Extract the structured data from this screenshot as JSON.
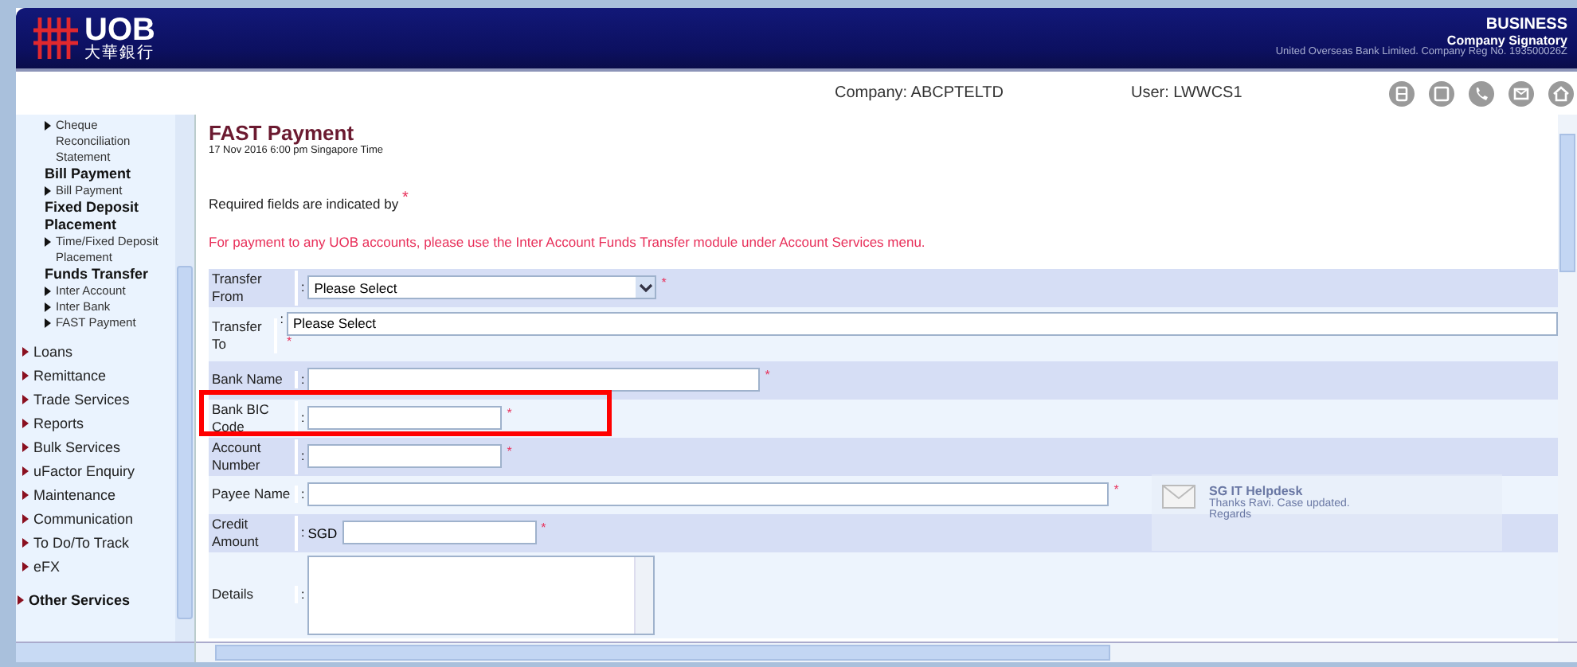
{
  "header": {
    "logo_text": "UOB",
    "logo_chinese": "大華銀行",
    "product": "BUSINESS",
    "role": "Company Signatory",
    "registration": "United Overseas Bank Limited. Company Reg No. 193500026Z"
  },
  "info_bar": {
    "company": "Company: ABCPTELTD",
    "user": "User: LWWCS1"
  },
  "sidebar": {
    "items": [
      {
        "kind": "sub",
        "label": "Cheque Reconciliation Statement"
      },
      {
        "kind": "heading",
        "label": "Bill Payment"
      },
      {
        "kind": "sub",
        "label": "Bill Payment"
      },
      {
        "kind": "heading",
        "label": "Fixed Deposit Placement"
      },
      {
        "kind": "sub",
        "label": "Time/Fixed Deposit Placement"
      },
      {
        "kind": "heading",
        "label": "Funds Transfer"
      },
      {
        "kind": "sub",
        "label": "Inter Account"
      },
      {
        "kind": "sub",
        "label": "Inter Bank"
      },
      {
        "kind": "sub",
        "label": "FAST Payment"
      },
      {
        "kind": "menu",
        "label": "Loans"
      },
      {
        "kind": "menu",
        "label": "Remittance"
      },
      {
        "kind": "menu",
        "label": "Trade Services"
      },
      {
        "kind": "menu",
        "label": "Reports"
      },
      {
        "kind": "menu",
        "label": "Bulk Services"
      },
      {
        "kind": "menu",
        "label": "uFactor Enquiry"
      },
      {
        "kind": "menu",
        "label": "Maintenance"
      },
      {
        "kind": "menu",
        "label": "Communication"
      },
      {
        "kind": "menu",
        "label": "To Do/To Track"
      },
      {
        "kind": "menu",
        "label": "eFX"
      },
      {
        "kind": "section",
        "label": "Other Services"
      }
    ]
  },
  "page": {
    "title": "FAST Payment",
    "timestamp": "17 Nov 2016 6:00 pm Singapore Time",
    "required_note": "Required fields are indicated by",
    "required_mark": "*",
    "notice": "For payment to any UOB accounts, please use the Inter Account Funds Transfer module under Account Services menu."
  },
  "form": {
    "separator": ":",
    "rows": [
      {
        "kind": "select",
        "label": "Transfer From",
        "value": "Please Select",
        "required": true,
        "highlighted": false
      },
      {
        "kind": "wide",
        "label": "Transfer To",
        "value": "Please Select",
        "required": true,
        "highlighted": false
      },
      {
        "kind": "text",
        "label": "Bank Name",
        "required": true,
        "highlighted": false
      },
      {
        "kind": "short",
        "label": "Bank BIC Code",
        "required": true,
        "highlighted": true
      },
      {
        "kind": "short",
        "label": "Account Number",
        "required": true,
        "highlighted": false
      },
      {
        "kind": "long",
        "label": "Payee Name",
        "required": true,
        "highlighted": false
      },
      {
        "kind": "amount",
        "label": "Credit Amount",
        "currency": "SGD",
        "required": true,
        "highlighted": false
      },
      {
        "kind": "textarea",
        "label": "Details",
        "required": false,
        "highlighted": false
      }
    ]
  },
  "notification": {
    "sender": "SG IT Helpdesk",
    "line_1": "Thanks Ravi. Case updated.",
    "line_2": "Regards"
  }
}
